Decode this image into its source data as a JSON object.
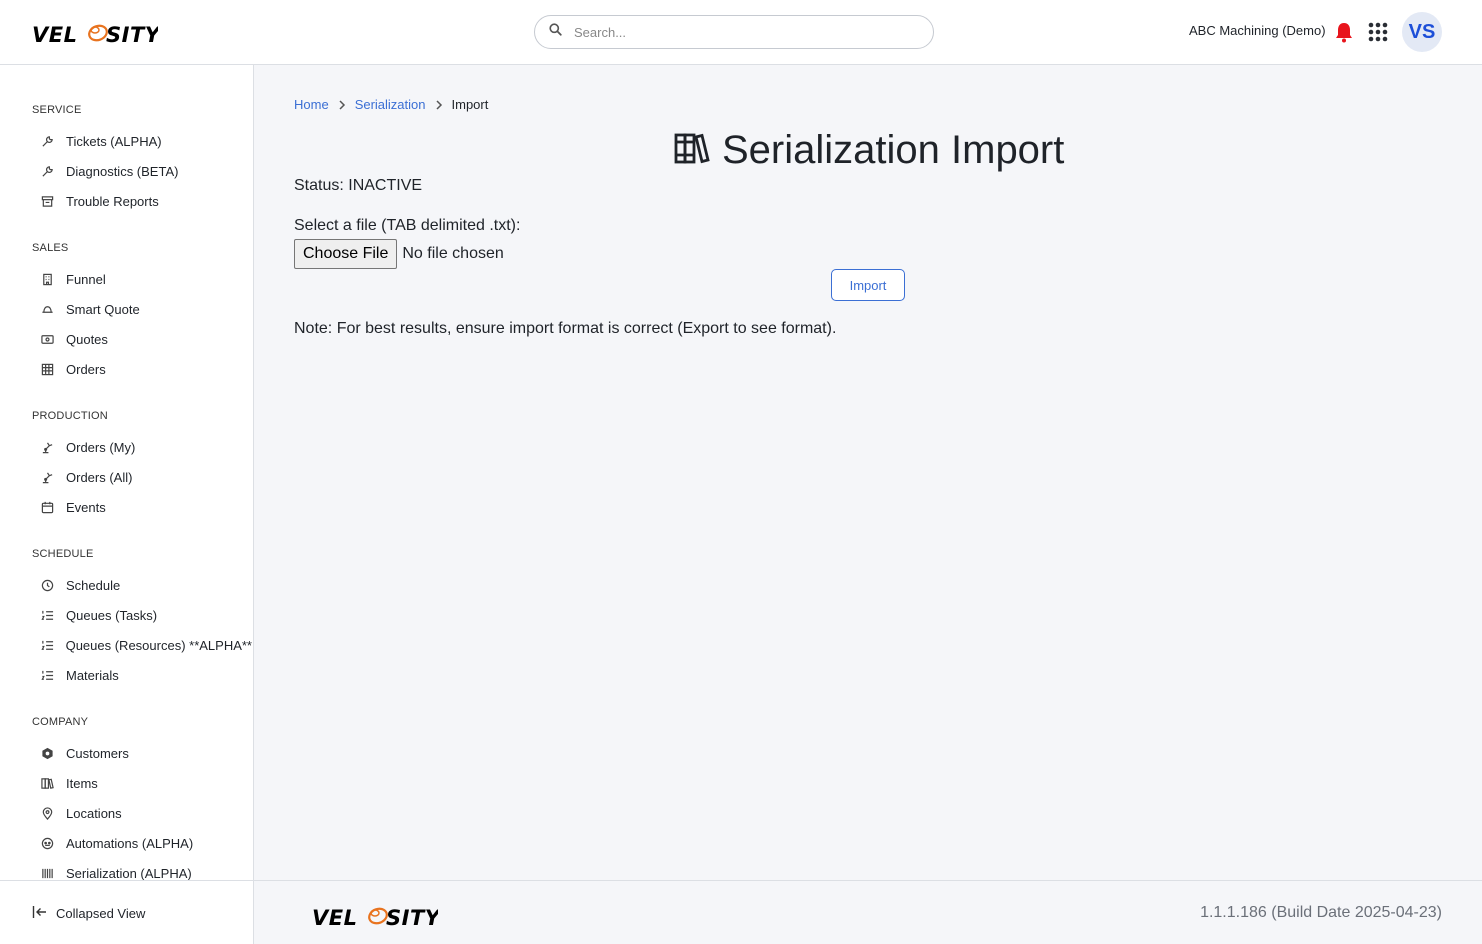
{
  "header": {
    "logo_text": "VELOSITY",
    "search_placeholder": "Search...",
    "company": "ABC Machining (Demo)",
    "avatar_initials": "VS",
    "accent_color": "#3b6fd4",
    "bell_color": "#e8141c"
  },
  "sidebar": {
    "sections": [
      {
        "title": "SERVICE",
        "items": [
          {
            "label": "Tickets (ALPHA)",
            "icon": "wrench-icon"
          },
          {
            "label": "Diagnostics (BETA)",
            "icon": "wrench-icon"
          },
          {
            "label": "Trouble Reports",
            "icon": "archive-icon"
          }
        ]
      },
      {
        "title": "SALES",
        "items": [
          {
            "label": "Funnel",
            "icon": "building-icon"
          },
          {
            "label": "Smart Quote",
            "icon": "hand-coin-icon"
          },
          {
            "label": "Quotes",
            "icon": "cash-icon"
          },
          {
            "label": "Orders",
            "icon": "table-icon"
          }
        ]
      },
      {
        "title": "PRODUCTION",
        "items": [
          {
            "label": "Orders (My)",
            "icon": "robot-arm-icon"
          },
          {
            "label": "Orders (All)",
            "icon": "robot-arm-icon"
          },
          {
            "label": "Events",
            "icon": "calendar-icon"
          }
        ]
      },
      {
        "title": "SCHEDULE",
        "items": [
          {
            "label": "Schedule",
            "icon": "clock-icon"
          },
          {
            "label": "Queues (Tasks)",
            "icon": "list-numbers-icon"
          },
          {
            "label": "Queues (Resources) **ALPHA**",
            "icon": "list-numbers-icon"
          },
          {
            "label": "Materials",
            "icon": "list-numbers-icon"
          }
        ]
      },
      {
        "title": "COMPANY",
        "items": [
          {
            "label": "Customers",
            "icon": "gear-badge-icon"
          },
          {
            "label": "Items",
            "icon": "books-icon"
          },
          {
            "label": "Locations",
            "icon": "map-pin-icon"
          },
          {
            "label": "Automations (ALPHA)",
            "icon": "robot-face-icon"
          },
          {
            "label": "Serialization (ALPHA)",
            "icon": "barcode-icon"
          }
        ]
      }
    ],
    "collapse_label": "Collapsed View"
  },
  "main": {
    "breadcrumb": {
      "home": "Home",
      "section": "Serialization",
      "current": "Import"
    },
    "title": "Serialization Import",
    "status": "Status: INACTIVE",
    "file_label": "Select a file (TAB delimited .txt):",
    "choose_file": "Choose File",
    "no_file": "No file chosen",
    "import_button": "Import",
    "note": "Note: For best results, ensure import format is correct (Export to see format)."
  },
  "footer": {
    "logo_text": "VELOSITY",
    "version": "1.1.1.186 (Build Date 2025-04-23)"
  }
}
